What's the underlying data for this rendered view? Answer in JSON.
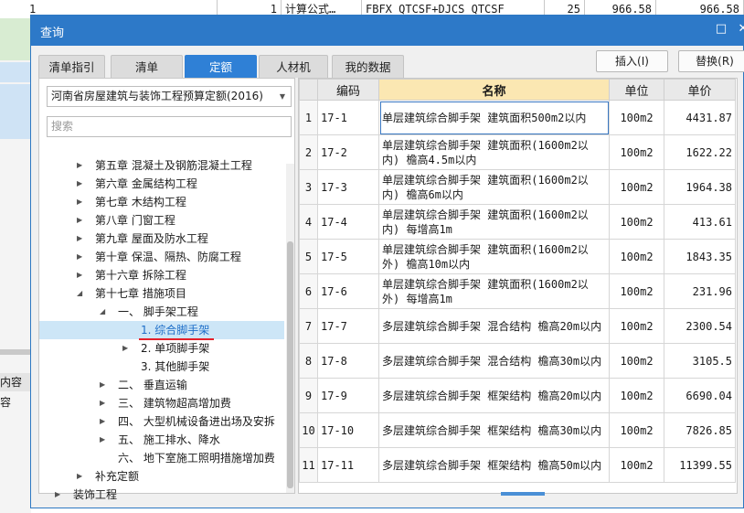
{
  "background_row": {
    "cells": [
      "1",
      "1",
      "计算公式…",
      "FBFX_QTCSF+DJCS_QTCSF",
      "25",
      "966.58",
      "966.58"
    ]
  },
  "background_left": {
    "labels": [
      "内容",
      "容"
    ]
  },
  "dialog": {
    "title": "查询",
    "restore_icon": "restore-icon",
    "close_icon": "close-icon"
  },
  "tabs": [
    {
      "label": "清单指引",
      "active": false
    },
    {
      "label": "清单",
      "active": false
    },
    {
      "label": "定额",
      "active": true
    },
    {
      "label": "人材机",
      "active": false
    },
    {
      "label": "我的数据",
      "active": false
    }
  ],
  "actions": {
    "insert": "插入(I)",
    "replace": "替换(R)"
  },
  "left_panel": {
    "library_select": "河南省房屋建筑与装饰工程预算定额(2016)",
    "search_placeholder": "搜索",
    "tree": [
      {
        "label": "第五章 混凝土及钢筋混凝土工程",
        "toggle": "collapsed"
      },
      {
        "label": "第六章 金属结构工程",
        "toggle": "collapsed"
      },
      {
        "label": "第七章 木结构工程",
        "toggle": "collapsed"
      },
      {
        "label": "第八章 门窗工程",
        "toggle": "collapsed"
      },
      {
        "label": "第九章 屋面及防水工程",
        "toggle": "collapsed"
      },
      {
        "label": "第十章 保温、隔热、防腐工程",
        "toggle": "collapsed"
      },
      {
        "label": "第十六章 拆除工程",
        "toggle": "collapsed"
      },
      {
        "label": "第十七章 措施项目",
        "toggle": "expanded"
      },
      {
        "label": "一、 脚手架工程",
        "toggle": "expanded"
      },
      {
        "label": "1. 综合脚手架",
        "toggle": "none",
        "selected": true
      },
      {
        "label": "2. 单项脚手架",
        "toggle": "collapsed"
      },
      {
        "label": "3. 其他脚手架",
        "toggle": "none"
      },
      {
        "label": "二、 垂直运输",
        "toggle": "collapsed"
      },
      {
        "label": "三、 建筑物超高增加费",
        "toggle": "collapsed"
      },
      {
        "label": "四、 大型机械设备进出场及安拆",
        "toggle": "collapsed"
      },
      {
        "label": "五、 施工排水、降水",
        "toggle": "collapsed"
      },
      {
        "label": "六、 地下室施工照明措施增加费",
        "toggle": "none"
      },
      {
        "label": "补充定额",
        "toggle": "collapsed"
      },
      {
        "label": "装饰工程",
        "toggle": "collapsed"
      }
    ]
  },
  "table": {
    "columns": [
      "编码",
      "名称",
      "单位",
      "单价"
    ],
    "rows": [
      {
        "idx": "1",
        "code": "17-1",
        "name": "单层建筑综合脚手架 建筑面积500m2以内",
        "unit": "100m2",
        "price": "4431.87"
      },
      {
        "idx": "2",
        "code": "17-2",
        "name": "单层建筑综合脚手架 建筑面积(1600m2以内) 檐高4.5m以内",
        "unit": "100m2",
        "price": "1622.22"
      },
      {
        "idx": "3",
        "code": "17-3",
        "name": "单层建筑综合脚手架 建筑面积(1600m2以内) 檐高6m以内",
        "unit": "100m2",
        "price": "1964.38"
      },
      {
        "idx": "4",
        "code": "17-4",
        "name": "单层建筑综合脚手架 建筑面积(1600m2以内) 每增高1m",
        "unit": "100m2",
        "price": "413.61"
      },
      {
        "idx": "5",
        "code": "17-5",
        "name": "单层建筑综合脚手架 建筑面积(1600m2以外) 檐高10m以内",
        "unit": "100m2",
        "price": "1843.35"
      },
      {
        "idx": "6",
        "code": "17-6",
        "name": "单层建筑综合脚手架 建筑面积(1600m2以外) 每增高1m",
        "unit": "100m2",
        "price": "231.96"
      },
      {
        "idx": "7",
        "code": "17-7",
        "name": "多层建筑综合脚手架 混合结构 檐高20m以内",
        "unit": "100m2",
        "price": "2300.54"
      },
      {
        "idx": "8",
        "code": "17-8",
        "name": "多层建筑综合脚手架 混合结构 檐高30m以内",
        "unit": "100m2",
        "price": "3105.5"
      },
      {
        "idx": "9",
        "code": "17-9",
        "name": "多层建筑综合脚手架 框架结构 檐高20m以内",
        "unit": "100m2",
        "price": "6690.04"
      },
      {
        "idx": "10",
        "code": "17-10",
        "name": "多层建筑综合脚手架 框架结构 檐高30m以内",
        "unit": "100m2",
        "price": "7826.85"
      },
      {
        "idx": "11",
        "code": "17-11",
        "name": "多层建筑综合脚手架 框架结构 檐高50m以内",
        "unit": "100m2",
        "price": "11399.55"
      }
    ]
  },
  "colors": {
    "titlebar": "#2d79c8",
    "active_tab": "#2f80d6",
    "name_header": "#fbe7b2",
    "selected_tree": "#cde6f7",
    "underline": "#e5202a"
  }
}
